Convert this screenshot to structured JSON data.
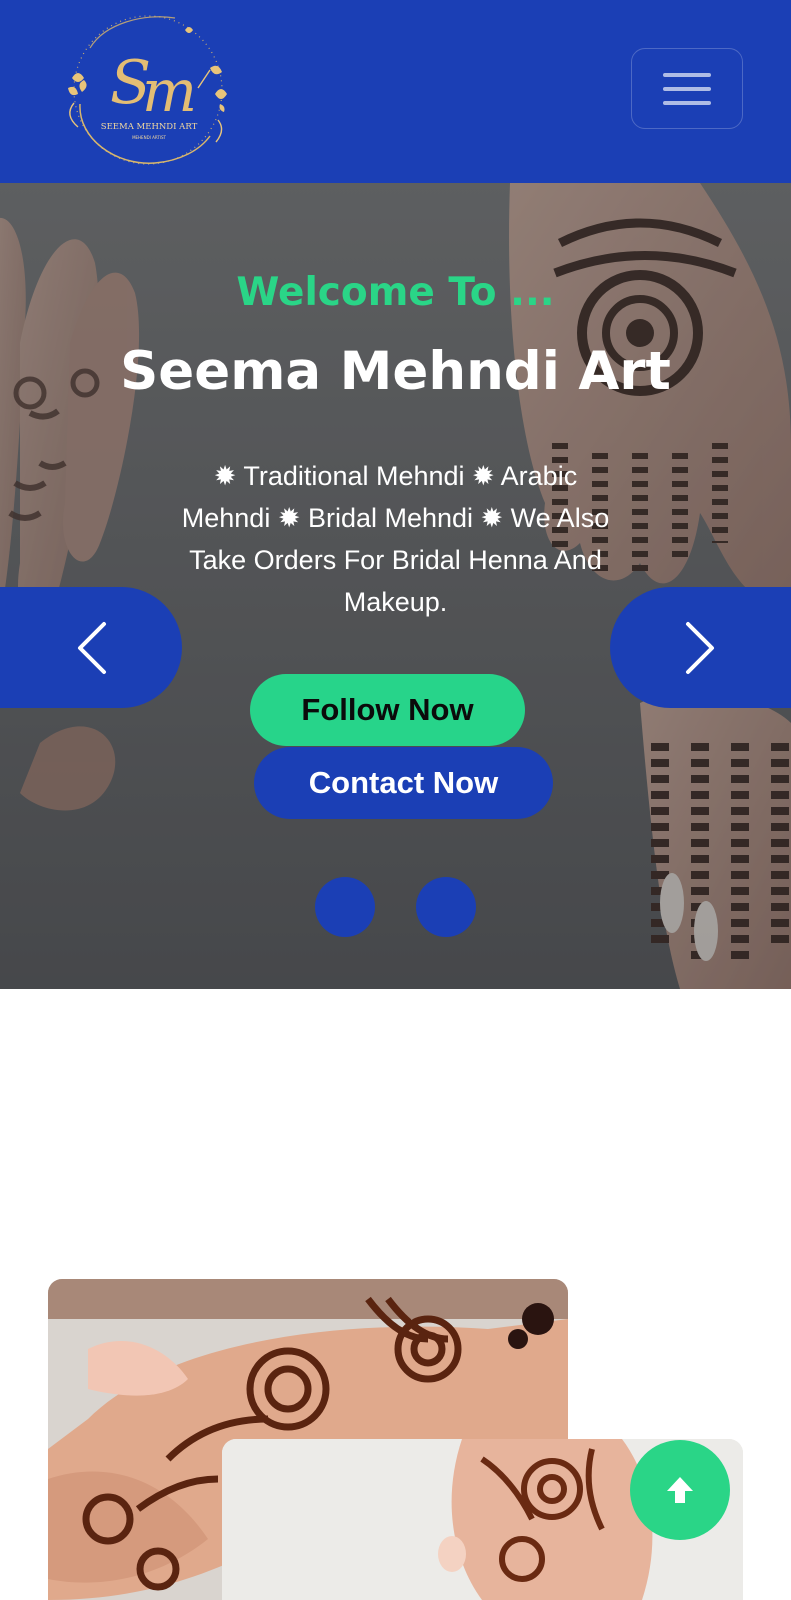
{
  "header": {
    "logo": {
      "monogram": "SM",
      "text": "SEEMA MEHNDI ART",
      "icon": "floral-wreath-logo"
    },
    "menu_icon": "hamburger-icon",
    "background": "#1b3fb5"
  },
  "hero": {
    "welcome": "Welcome To ...",
    "title": "Seema Mehndi Art",
    "description": "✹ Traditional Mehndi ✹ Arabic Mehndi ✹ Bridal Mehndi ✹ We Also Take Orders For Bridal Henna And Makeup.",
    "follow_button": "Follow Now",
    "contact_button": "Contact Now",
    "prev_icon": "chevron-left-icon",
    "next_icon": "chevron-right-icon",
    "slide_count": 2,
    "accent_color": "#2ad587",
    "brand_color": "#1b3fb5"
  },
  "back_to_top": {
    "icon": "arrow-up-icon"
  }
}
